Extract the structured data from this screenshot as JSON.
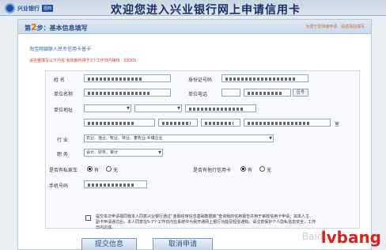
{
  "header": {
    "logo_cn": "兴业银行",
    "logo_sub": "招商",
    "banner": "欢迎您进入兴业银行网上申请信用卡"
  },
  "step": {
    "prefix": "第",
    "num": "2",
    "suffix": "步：基本信息填写",
    "note": "为便于您快速申请 · 请选择后填写"
  },
  "card_title": "淘宝网银联人民币信用卡普卡",
  "warning": "请完整填写以下内容 有效期内将于3个工作日内审核 · 09301",
  "form": {
    "name_label": "姓  名",
    "id_label": "身份证号码",
    "company_label": "单位名称",
    "company_phone_label": "单位电话",
    "company_addr_label": "单位地址",
    "phone_search": "区号",
    "industry_label": "行  业",
    "industry_value": "农业、渔业、牧业、林业、畜牧业·乡镇企业",
    "position_label": "职  务",
    "position_value": "会计、财务、审计",
    "house_label": "是否有私家车",
    "house_yes": "有",
    "house_no": "无",
    "card_label": "是否有他行信用卡",
    "card_yes": "有",
    "card_no": "无",
    "mobile_label": "手机号码",
    "building_suffix": "室"
  },
  "agreement": "提交本次申请视同我本人同意兴业银行通过“金融信用信息基础数据库”查询我的信用报告并用于审核信用卡申请；如本人主、副卡申请通过后，本人同意在5-7个工作日内在系统中为我开通网上银行功能及短信通知。请注意保护个人隐私信息安全，工作日内达成。",
  "buttons": {
    "submit": "提交信息",
    "cancel": "取消申请"
  },
  "watermark": "lvbang",
  "watermark2": "Baidu"
}
